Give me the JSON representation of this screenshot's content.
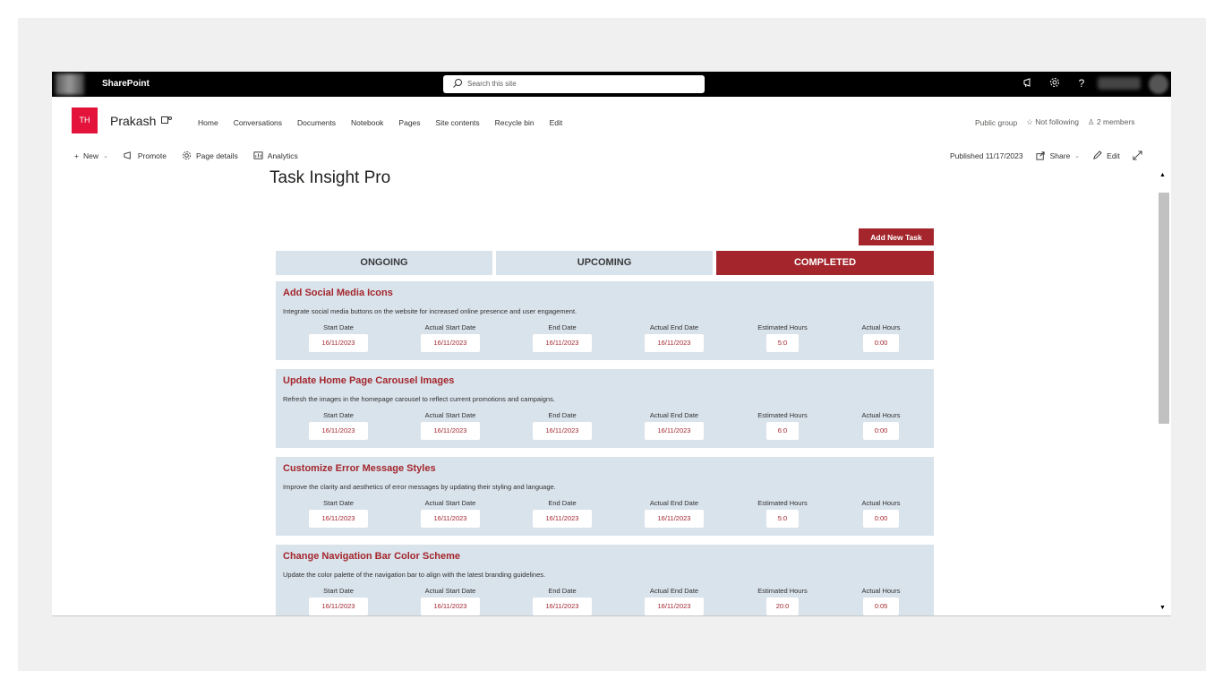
{
  "suitebar": {
    "brand": "SharePoint",
    "search_placeholder": "Search this site",
    "help": "?"
  },
  "site": {
    "logo_initials": "TH",
    "title": "Prakash",
    "nav": [
      "Home",
      "Conversations",
      "Documents",
      "Notebook",
      "Pages",
      "Site contents",
      "Recycle bin",
      "Edit"
    ],
    "group_type": "Public group",
    "follow": "Not following",
    "members": "2 members"
  },
  "commandbar": {
    "new": "New",
    "promote": "Promote",
    "page_details": "Page details",
    "analytics": "Analytics",
    "published": "Published 11/17/2023",
    "share": "Share",
    "edit": "Edit"
  },
  "page": {
    "title": "Task Insight Pro",
    "add_button": "Add New Task",
    "tabs": [
      "ONGOING",
      "UPCOMING",
      "COMPLETED"
    ],
    "active_tab": "COMPLETED",
    "field_labels": [
      "Start Date",
      "Actual Start Date",
      "End Date",
      "Actual End Date",
      "Estimated Hours",
      "Actual Hours"
    ],
    "tasks": [
      {
        "title": "Add Social Media Icons",
        "description": "Integrate social media buttons on the website for increased online presence and user engagement.",
        "values": [
          "16/11/2023",
          "16/11/2023",
          "16/11/2023",
          "16/11/2023",
          "5:0",
          "0:00"
        ]
      },
      {
        "title": "Update Home Page Carousel Images",
        "description": "Refresh the images in the homepage carousel to reflect current promotions and campaigns.",
        "values": [
          "16/11/2023",
          "16/11/2023",
          "16/11/2023",
          "16/11/2023",
          "6:0",
          "0:00"
        ]
      },
      {
        "title": "Customize Error Message Styles",
        "description": "Improve the clarity and aesthetics of error messages by updating their styling and language.",
        "values": [
          "16/11/2023",
          "16/11/2023",
          "16/11/2023",
          "16/11/2023",
          "5:0",
          "0:00"
        ]
      },
      {
        "title": "Change Navigation Bar Color Scheme",
        "description": "Update the color palette of the navigation bar to align with the latest branding guidelines.",
        "values": [
          "16/11/2023",
          "16/11/2023",
          "16/11/2023",
          "16/11/2023",
          "20:0",
          "0:05"
        ]
      }
    ]
  },
  "colors": {
    "accent": "#a4262c",
    "card_bg": "#d9e3ec",
    "logo": "#e3133b"
  }
}
